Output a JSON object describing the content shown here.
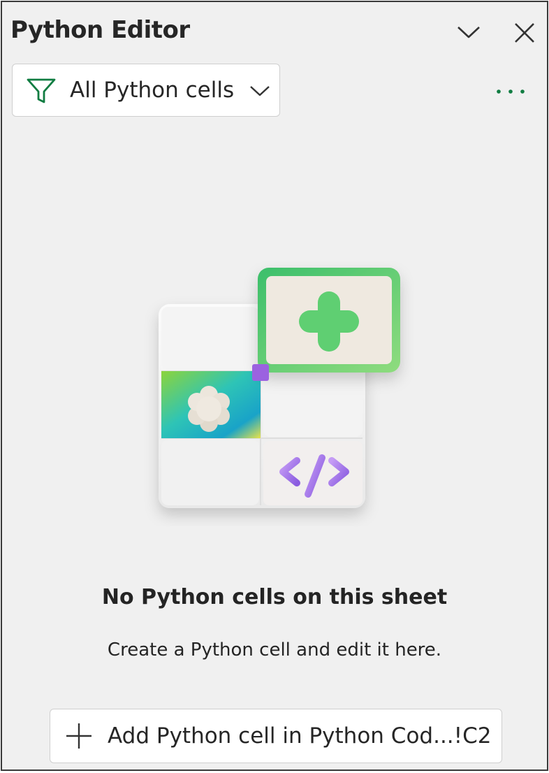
{
  "pane": {
    "title": "Python Editor",
    "collapse_icon": "chevron-down-icon",
    "close_icon": "close-icon"
  },
  "filter": {
    "icon": "filter-icon",
    "label": "All Python cells",
    "dropdown_icon": "chevron-down-icon"
  },
  "more_options_icon": "more-horizontal-icon",
  "empty_state": {
    "illustration": "python-cells-illustration",
    "title": "No Python cells on this sheet",
    "description": "Create a Python cell and edit it here."
  },
  "add_button": {
    "icon": "plus-icon",
    "label": "Add Python cell in Python Cod...!C2"
  },
  "colors": {
    "accent_green": "#107c41",
    "pane_background": "#f0f0f0",
    "text": "#242424"
  }
}
